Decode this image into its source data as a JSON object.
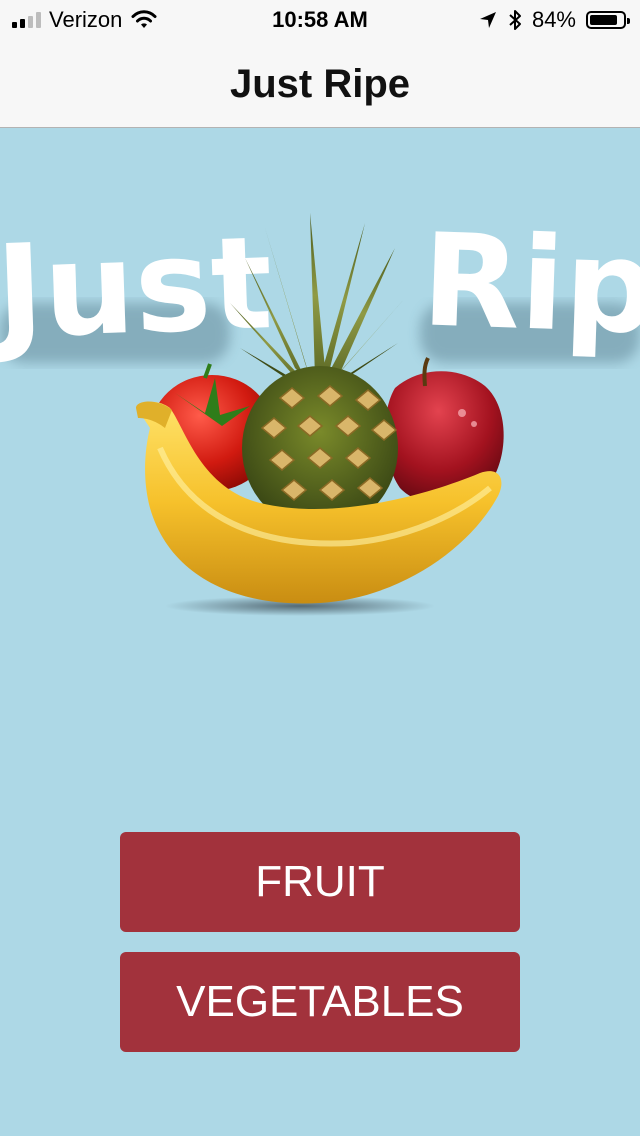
{
  "status_bar": {
    "carrier": "Verizon",
    "time": "10:58 AM",
    "battery_percent": "84%",
    "battery_level": 0.84,
    "signal_bars": 2
  },
  "nav": {
    "title": "Just Ripe"
  },
  "hero": {
    "logo_text_left": "Just",
    "logo_text_right": "Ripe"
  },
  "buttons": {
    "fruit_label": "FRUIT",
    "vegetables_label": "VEGETABLES",
    "color": "#a2323c"
  },
  "colors": {
    "background": "#add8e6",
    "nav_background": "#f7f7f7"
  }
}
